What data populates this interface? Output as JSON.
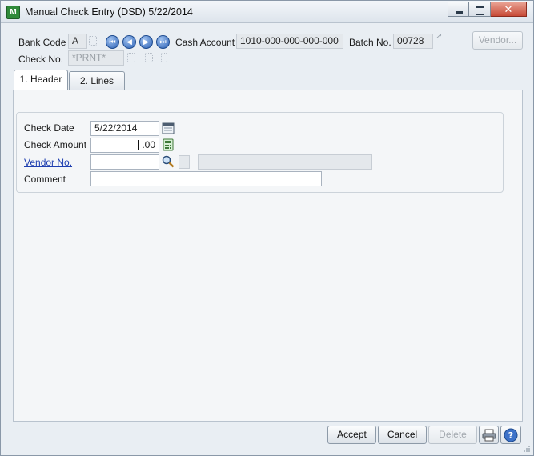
{
  "window": {
    "title": "Manual Check Entry (DSD) 5/22/2014",
    "app_icon_letter": "M",
    "close_glyph": "✕"
  },
  "header": {
    "bank_code_label": "Bank Code",
    "bank_code_value": "A",
    "cash_account_label": "Cash Account",
    "cash_account_value": "1010-000-000-000-000",
    "batch_no_label": "Batch No.",
    "batch_no_value": "00728",
    "vendor_button": "Vendor...",
    "check_no_label": "Check No.",
    "check_no_value": "*PRNT*",
    "nav_first": "⏮",
    "nav_prev": "◀",
    "nav_next": "▶",
    "nav_last": "⏭"
  },
  "tabs": [
    {
      "label": "1. Header",
      "active": true
    },
    {
      "label": "2. Lines",
      "active": false
    }
  ],
  "form": {
    "check_date_label": "Check Date",
    "check_date_value": "5/22/2014",
    "check_amount_label": "Check Amount",
    "check_amount_value": ".00",
    "vendor_no_label": "Vendor No.",
    "vendor_no_value": "",
    "comment_label": "Comment",
    "comment_value": ""
  },
  "footer": {
    "accept": "Accept",
    "cancel": "Cancel",
    "delete": "Delete"
  },
  "colors": {
    "accent_link": "#1f3fb0",
    "close_button": "#c74a37"
  }
}
